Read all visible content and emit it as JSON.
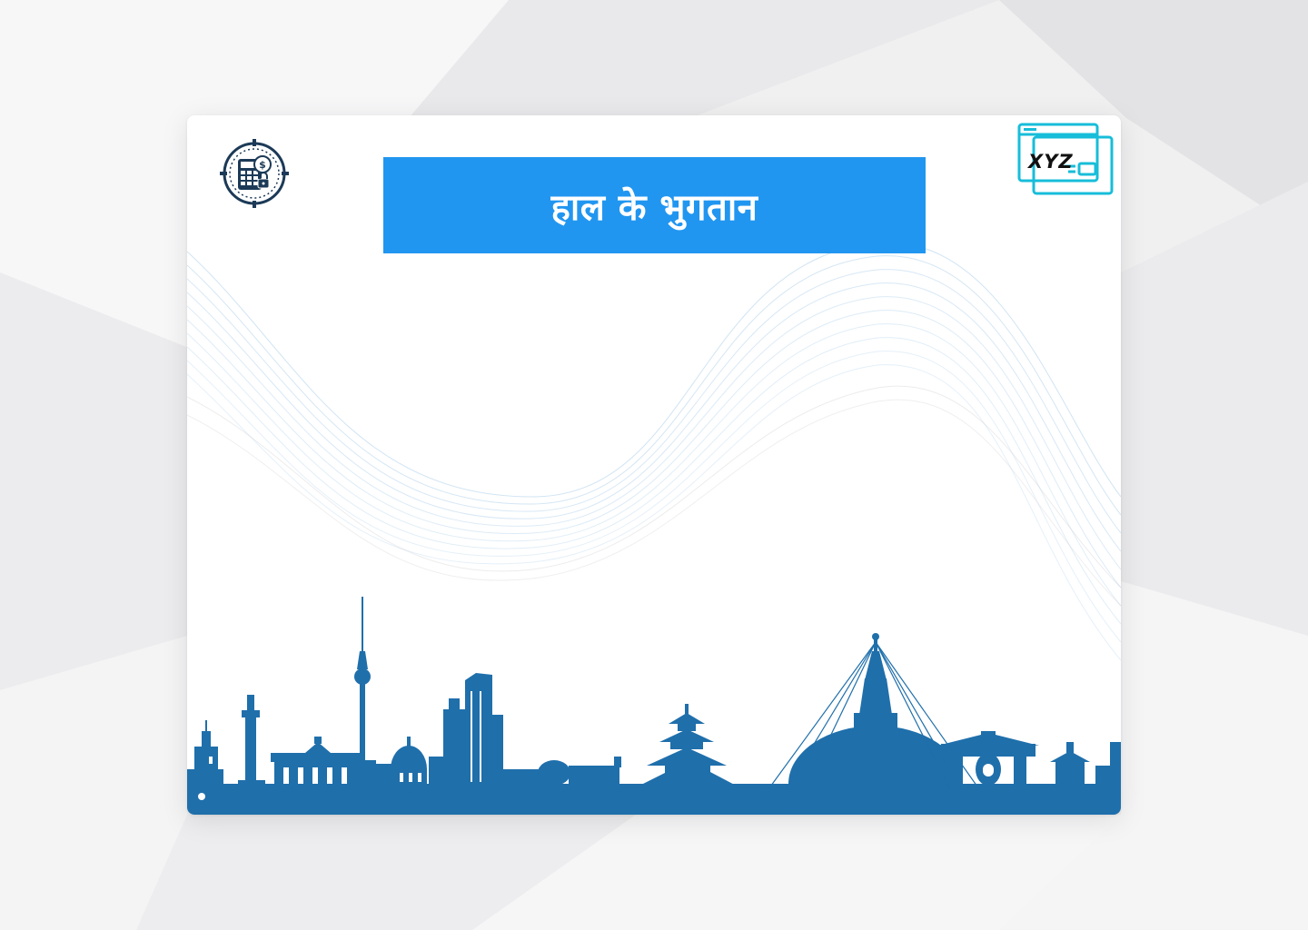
{
  "page": {
    "title": "हाल के भुगतान"
  },
  "logos": {
    "left_icon": "calculator-dollar-lock-badge-icon",
    "right_text": "XYZ",
    "right_icon": "browser-windows-icon"
  },
  "decorations": {
    "wave": "wave-lines-icon",
    "skyline": "city-skyline-silhouette-icon"
  },
  "colors": {
    "banner": "#2196f0",
    "skyline": "#1f6fab",
    "logo_dark": "#1c3a57",
    "logo_cyan": "#17bdd9",
    "wave": "#8fbfe6"
  }
}
